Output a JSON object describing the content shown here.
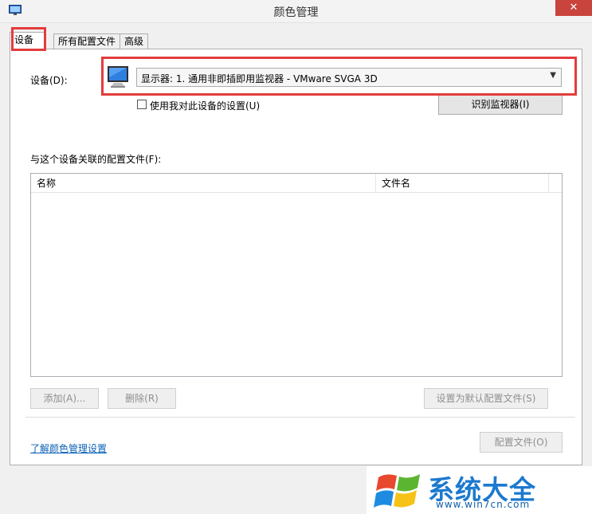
{
  "window": {
    "title": "颜色管理",
    "close_label": "✕"
  },
  "tabs": [
    {
      "label": "设备",
      "active": true
    },
    {
      "label": "所有配置文件",
      "active": false
    },
    {
      "label": "高级",
      "active": false
    }
  ],
  "device": {
    "label": "设备(D):",
    "selected": "显示器: 1. 通用非即插即用监视器 - VMware SVGA 3D",
    "checkbox_label": "使用我对此设备的设置(U)",
    "checkbox_checked": false,
    "identify_button": "识别监视器(I)"
  },
  "profiles": {
    "label": "与这个设备关联的配置文件(F):",
    "columns": [
      "名称",
      "文件名"
    ],
    "rows": []
  },
  "actions": {
    "add": "添加(A)...",
    "remove": "删除(R)",
    "set_default": "设置为默认配置文件(S)",
    "profiles": "配置文件(O)"
  },
  "link": "了解颜色管理设置",
  "watermark": {
    "title": "系统大全",
    "url": "www.win7cn.com"
  },
  "colors": {
    "highlight": "#e33c3c",
    "close": "#c9443c",
    "link": "#0b61b5",
    "brand": "#1b79cf"
  }
}
